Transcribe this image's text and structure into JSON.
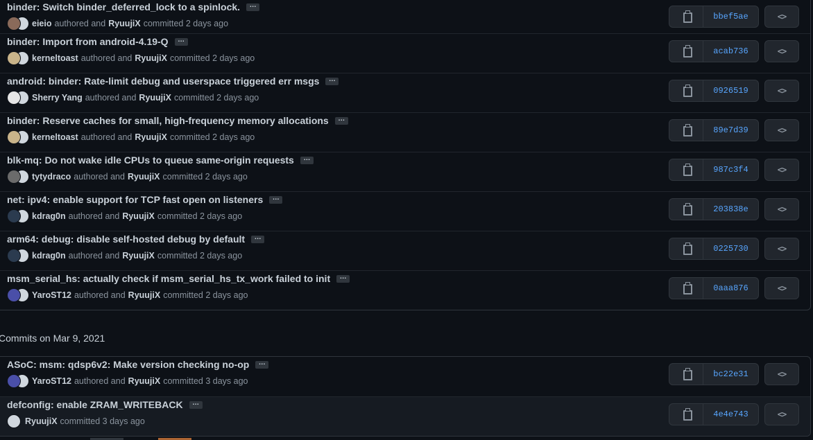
{
  "groups": [
    {
      "commits": [
        {
          "message": "binder: Switch binder_deferred_lock to a spinlock.",
          "author": "eieio",
          "committer": "RyuujiX",
          "authored_text": "authored and",
          "committed_text": "committed 2 days ago",
          "sha": "bbef5ae",
          "avatar_color": "#8a6a5a"
        },
        {
          "message": "binder: Import from android-4.19-Q",
          "author": "kerneltoast",
          "committer": "RyuujiX",
          "authored_text": "authored and",
          "committed_text": "committed 2 days ago",
          "sha": "acab736",
          "avatar_color": "#c9b48a"
        },
        {
          "message": "android: binder: Rate-limit debug and userspace triggered err msgs",
          "author": "Sherry Yang",
          "committer": "RyuujiX",
          "authored_text": "authored and",
          "committed_text": "committed 2 days ago",
          "sha": "0926519",
          "avatar_color": "#e6e6e6"
        },
        {
          "message": "binder: Reserve caches for small, high-frequency memory allocations",
          "author": "kerneltoast",
          "committer": "RyuujiX",
          "authored_text": "authored and",
          "committed_text": "committed 2 days ago",
          "sha": "89e7d39",
          "avatar_color": "#c9b48a"
        },
        {
          "message": "blk-mq: Do not wake idle CPUs to queue same-origin requests",
          "author": "tytydraco",
          "committer": "RyuujiX",
          "authored_text": "authored and",
          "committed_text": "committed 2 days ago",
          "sha": "987c3f4",
          "avatar_color": "#6b6b6b"
        },
        {
          "message": "net: ipv4: enable support for TCP fast open on listeners",
          "author": "kdrag0n",
          "committer": "RyuujiX",
          "authored_text": "authored and",
          "committed_text": "committed 2 days ago",
          "sha": "203838e",
          "avatar_color": "#2b3b4f"
        },
        {
          "message": "arm64: debug: disable self-hosted debug by default",
          "author": "kdrag0n",
          "committer": "RyuujiX",
          "authored_text": "authored and",
          "committed_text": "committed 2 days ago",
          "sha": "0225730",
          "avatar_color": "#2b3b4f"
        },
        {
          "message": "msm_serial_hs: actually check if msm_serial_hs_tx_work failed to init",
          "author": "YaroST12",
          "committer": "RyuujiX",
          "authored_text": "authored and",
          "committed_text": "committed 2 days ago",
          "sha": "0aaa876",
          "avatar_color": "#4a4fa8"
        }
      ]
    },
    {
      "header": "Commits on Mar 9, 2021",
      "commits": [
        {
          "message": "ASoC: msm: qdsp6v2: Make version checking no-op",
          "author": "YaroST12",
          "committer": "RyuujiX",
          "authored_text": "authored and",
          "committed_text": "committed 3 days ago",
          "sha": "bc22e31",
          "avatar_color": "#4a4fa8"
        },
        {
          "message": "defconfig: enable ZRAM_WRITEBACK",
          "author": "",
          "committer": "RyuujiX",
          "authored_text": "",
          "committed_text": "committed 3 days ago",
          "sha": "4e4e743",
          "avatar_color": "#d0d7de"
        }
      ]
    }
  ],
  "ellipsis_label": "…",
  "browse_label": "<>",
  "icons": {
    "copy": "clippy-icon",
    "browse": "code-icon"
  },
  "colors": {
    "sha": "#58a6ff",
    "bg": "#0d1117",
    "border": "#30363d"
  }
}
